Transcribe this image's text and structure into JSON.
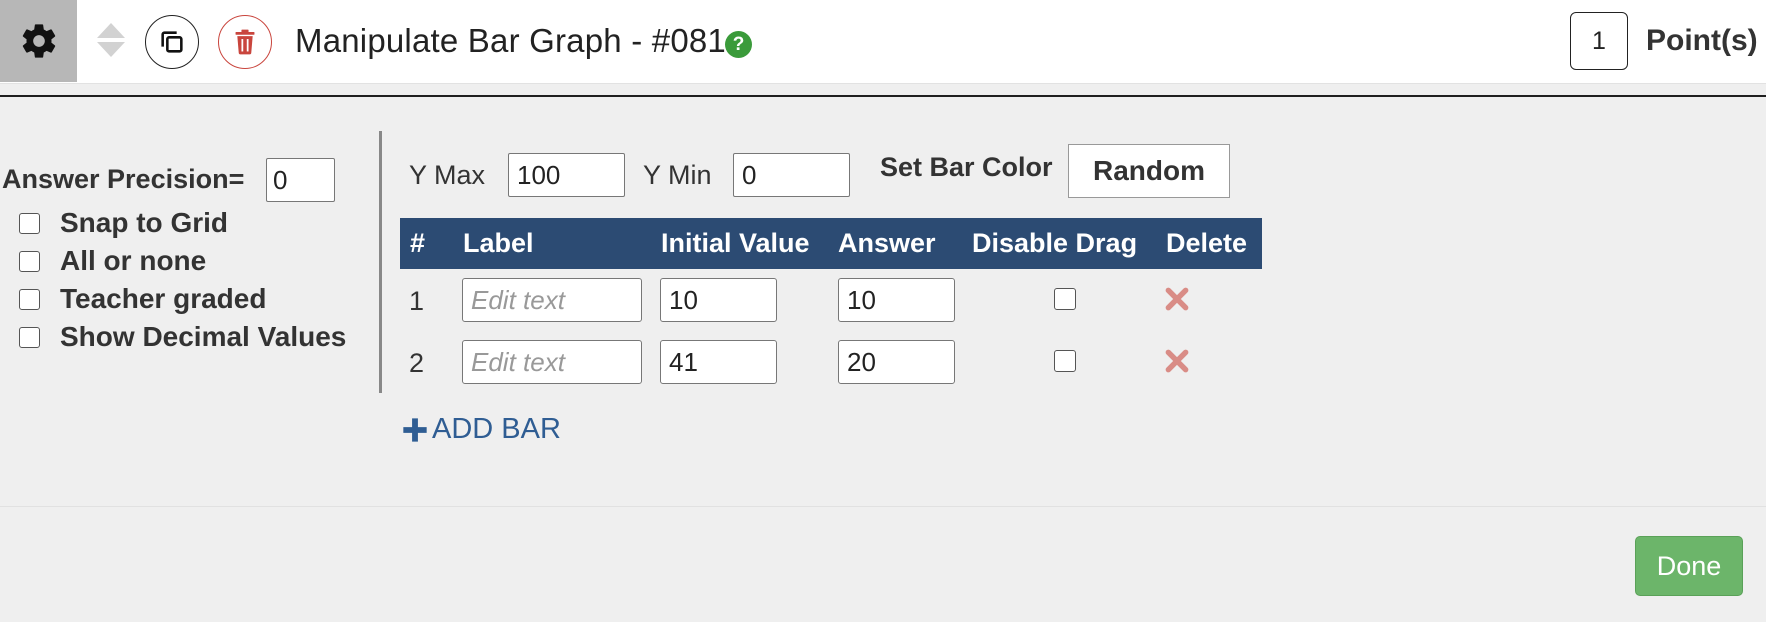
{
  "header": {
    "title": "Manipulate Bar Graph - #081",
    "help_glyph": "?",
    "points_value": "1",
    "points_label": "Point(s)",
    "icons": {
      "settings": "gear-icon",
      "reorder": "sort-arrows-icon",
      "duplicate": "copy-icon",
      "delete": "trash-icon",
      "help": "help-icon"
    }
  },
  "options": {
    "precision_label": "Answer Precision=",
    "precision_value": "0",
    "checkboxes": [
      {
        "label": "Snap to Grid",
        "checked": false
      },
      {
        "label": "All or none",
        "checked": false
      },
      {
        "label": "Teacher graded",
        "checked": false
      },
      {
        "label": "Show Decimal Values",
        "checked": false
      }
    ]
  },
  "axis": {
    "ymax_label": "Y Max",
    "ymax_value": "100",
    "ymin_label": "Y Min",
    "ymin_value": "0",
    "bar_color_label": "Set Bar Color",
    "bar_color_button": "Random"
  },
  "table": {
    "headers": [
      "#",
      "Label",
      "Initial Value",
      "Answer",
      "Disable Drag",
      "Delete"
    ],
    "label_placeholder": "Edit text",
    "rows": [
      {
        "num": "1",
        "label": "",
        "initial": "10",
        "answer": "10",
        "disable_drag": false
      },
      {
        "num": "2",
        "label": "",
        "initial": "41",
        "answer": "20",
        "disable_drag": false
      }
    ]
  },
  "add_bar_label": "ADD BAR",
  "done_label": "Done",
  "colors": {
    "header_bg": "#2c4b73",
    "done_bg": "#6cb56a",
    "delete_red": "#d98c86",
    "trash_red": "#c9453d",
    "help_green": "#3b9b3b",
    "link_blue": "#2f5d93"
  }
}
